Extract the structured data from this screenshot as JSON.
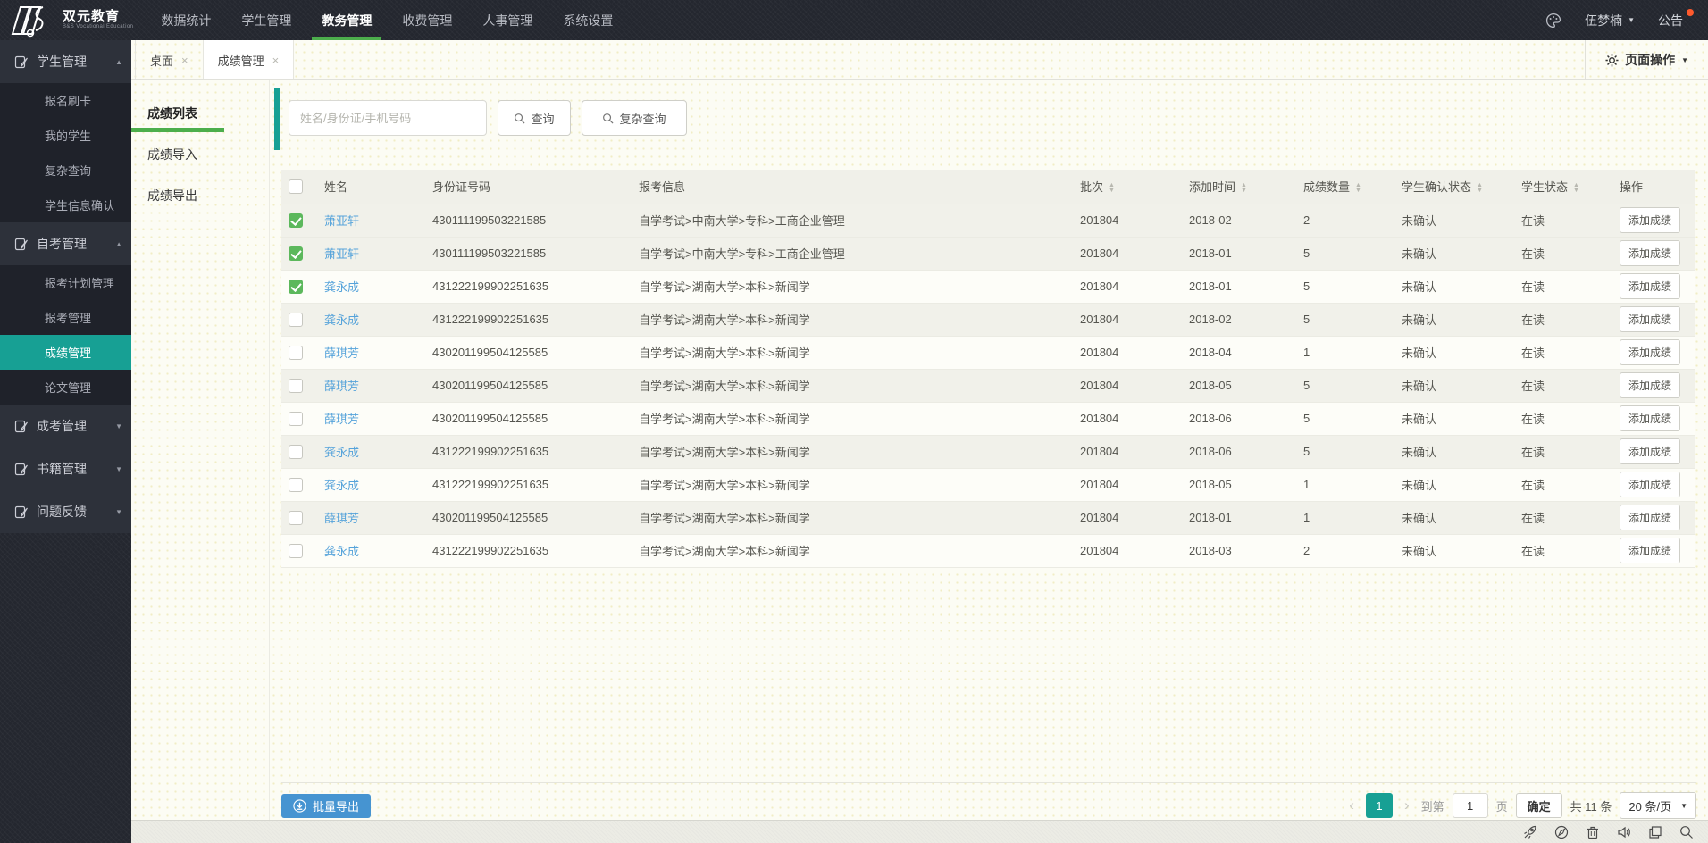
{
  "colors": {
    "accent_teal": "#17a094",
    "green_underline": "#4cae4c",
    "checkbox_green": "#5cb85c",
    "link_blue": "#56a3da",
    "button_blue": "#4694d1",
    "topbar_bg": "#24272f"
  },
  "topbar": {
    "logo_title": "双元教育",
    "logo_subtitle": "B&S Vocational Education",
    "nav": [
      {
        "label": "数据统计",
        "active": false
      },
      {
        "label": "学生管理",
        "active": false
      },
      {
        "label": "教务管理",
        "active": true
      },
      {
        "label": "收费管理",
        "active": false
      },
      {
        "label": "人事管理",
        "active": false
      },
      {
        "label": "系统设置",
        "active": false
      }
    ],
    "user": {
      "name": "伍梦楠"
    },
    "notice_label": "公告"
  },
  "tabbar": {
    "tabs": [
      {
        "label": "桌面",
        "active": false
      },
      {
        "label": "成绩管理",
        "active": true
      }
    ],
    "page_actions_label": "页面操作"
  },
  "sidebar": {
    "sections": [
      {
        "title": "学生管理",
        "expanded": true,
        "items": [
          {
            "label": "报名刷卡"
          },
          {
            "label": "我的学生"
          },
          {
            "label": "复杂查询"
          },
          {
            "label": "学生信息确认"
          }
        ]
      },
      {
        "title": "自考管理",
        "expanded": true,
        "items": [
          {
            "label": "报考计划管理"
          },
          {
            "label": "报考管理"
          },
          {
            "label": "成绩管理",
            "active": true
          },
          {
            "label": "论文管理"
          }
        ]
      },
      {
        "title": "成考管理",
        "expanded": false,
        "items": []
      },
      {
        "title": "书籍管理",
        "expanded": false,
        "items": []
      },
      {
        "title": "问题反馈",
        "expanded": false,
        "items": []
      }
    ]
  },
  "subnav": {
    "items": [
      {
        "label": "成绩列表",
        "active": true
      },
      {
        "label": "成绩导入",
        "active": false
      },
      {
        "label": "成绩导出",
        "active": false
      }
    ]
  },
  "search": {
    "placeholder": "姓名/身份证/手机号码",
    "query_label": "查询",
    "complex_query_label": "复杂查询"
  },
  "table": {
    "columns": [
      {
        "label": "",
        "type": "checkbox",
        "sortable": false
      },
      {
        "label": "姓名",
        "sortable": false
      },
      {
        "label": "身份证号码",
        "sortable": false
      },
      {
        "label": "报考信息",
        "sortable": false
      },
      {
        "label": "批次",
        "sortable": true
      },
      {
        "label": "添加时间",
        "sortable": true
      },
      {
        "label": "成绩数量",
        "sortable": true
      },
      {
        "label": "学生确认状态",
        "sortable": true
      },
      {
        "label": "学生状态",
        "sortable": true
      },
      {
        "label": "操作",
        "sortable": false
      }
    ],
    "action_label": "添加成绩",
    "rows": [
      {
        "checked": true,
        "name": "萧亚轩",
        "id_number": "430111199503221585",
        "enroll_info": "自学考试>中南大学>专科>工商企业管理",
        "batch": "201804",
        "added_time": "2018-02",
        "score_count": "2",
        "confirm_status": "未确认",
        "student_status": "在读"
      },
      {
        "checked": true,
        "name": "萧亚轩",
        "id_number": "430111199503221585",
        "enroll_info": "自学考试>中南大学>专科>工商企业管理",
        "batch": "201804",
        "added_time": "2018-01",
        "score_count": "5",
        "confirm_status": "未确认",
        "student_status": "在读"
      },
      {
        "checked": true,
        "name": "龚永成",
        "id_number": "431222199902251635",
        "enroll_info": "自学考试>湖南大学>本科>新闻学",
        "batch": "201804",
        "added_time": "2018-01",
        "score_count": "5",
        "confirm_status": "未确认",
        "student_status": "在读"
      },
      {
        "checked": false,
        "name": "龚永成",
        "id_number": "431222199902251635",
        "enroll_info": "自学考试>湖南大学>本科>新闻学",
        "batch": "201804",
        "added_time": "2018-02",
        "score_count": "5",
        "confirm_status": "未确认",
        "student_status": "在读"
      },
      {
        "checked": false,
        "name": "薛琪芳",
        "id_number": "430201199504125585",
        "enroll_info": "自学考试>湖南大学>本科>新闻学",
        "batch": "201804",
        "added_time": "2018-04",
        "score_count": "1",
        "confirm_status": "未确认",
        "student_status": "在读"
      },
      {
        "checked": false,
        "name": "薛琪芳",
        "id_number": "430201199504125585",
        "enroll_info": "自学考试>湖南大学>本科>新闻学",
        "batch": "201804",
        "added_time": "2018-05",
        "score_count": "5",
        "confirm_status": "未确认",
        "student_status": "在读"
      },
      {
        "checked": false,
        "name": "薛琪芳",
        "id_number": "430201199504125585",
        "enroll_info": "自学考试>湖南大学>本科>新闻学",
        "batch": "201804",
        "added_time": "2018-06",
        "score_count": "5",
        "confirm_status": "未确认",
        "student_status": "在读"
      },
      {
        "checked": false,
        "name": "龚永成",
        "id_number": "431222199902251635",
        "enroll_info": "自学考试>湖南大学>本科>新闻学",
        "batch": "201804",
        "added_time": "2018-06",
        "score_count": "5",
        "confirm_status": "未确认",
        "student_status": "在读"
      },
      {
        "checked": false,
        "name": "龚永成",
        "id_number": "431222199902251635",
        "enroll_info": "自学考试>湖南大学>本科>新闻学",
        "batch": "201804",
        "added_time": "2018-05",
        "score_count": "1",
        "confirm_status": "未确认",
        "student_status": "在读"
      },
      {
        "checked": false,
        "name": "薛琪芳",
        "id_number": "430201199504125585",
        "enroll_info": "自学考试>湖南大学>本科>新闻学",
        "batch": "201804",
        "added_time": "2018-01",
        "score_count": "1",
        "confirm_status": "未确认",
        "student_status": "在读"
      },
      {
        "checked": false,
        "name": "龚永成",
        "id_number": "431222199902251635",
        "enroll_info": "自学考试>湖南大学>本科>新闻学",
        "batch": "201804",
        "added_time": "2018-03",
        "score_count": "2",
        "confirm_status": "未确认",
        "student_status": "在读"
      }
    ],
    "shaded_row_indexes": [
      0,
      1,
      3,
      5,
      7,
      9
    ]
  },
  "footer": {
    "batch_export_label": "批量导出",
    "pagination": {
      "prev": "‹",
      "next": "›",
      "current_page": "1",
      "goto_label": "到第",
      "goto_value": "1",
      "page_unit": "页",
      "confirm_label": "确定",
      "total_label": "共 11 条",
      "page_size_label": "20 条/页"
    }
  },
  "statusbar": {
    "icons": [
      "rocket-icon",
      "browser-icon",
      "trash-icon",
      "volume-icon",
      "window-icon",
      "search-icon"
    ]
  }
}
